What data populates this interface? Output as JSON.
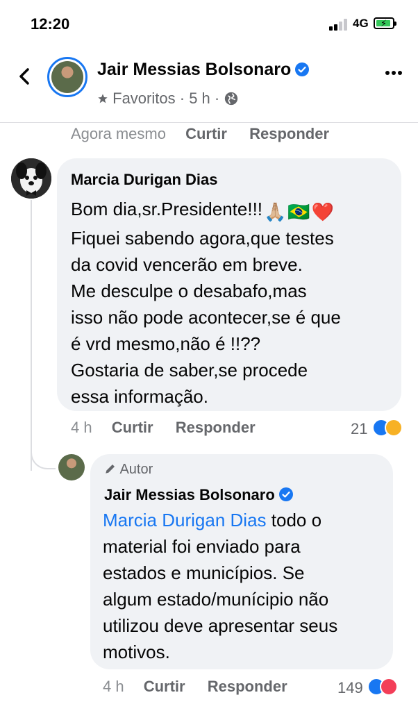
{
  "status_bar": {
    "time": "12:20",
    "network": "4G"
  },
  "header": {
    "page_name": "Jair Messias Bolsonaro",
    "favorites_label": "Favoritos",
    "separator": "·",
    "time_ago": "5 h"
  },
  "top_actions": {
    "time": "Agora mesmo",
    "like": "Curtir",
    "reply": "Responder"
  },
  "comment": {
    "author": "Marcia Durigan Dias",
    "lines": [
      "Bom dia,sr.Presidente!!!",
      "Fiquei sabendo agora,que testes",
      "da covid vencerão em breve.",
      "Me desculpe o desabafo,mas",
      "isso não pode acontecer,se é que",
      "é vrd mesmo,não é !!??",
      "Gostaria de saber,se procede",
      "essa informação."
    ],
    "emojis": [
      "🙏🏼",
      "🇧🇷",
      "❤️"
    ],
    "time": "4 h",
    "like": "Curtir",
    "reply": "Responder",
    "reaction_count": "21"
  },
  "reply": {
    "badge": "Autor",
    "author": "Jair Messias Bolsonaro",
    "mention": "Marcia Durigan Dias",
    "line1_rest": " todo o",
    "lines": [
      "material foi enviado para",
      "estados e municípios. Se",
      "algum estado/munícipio não",
      "utilizou deve apresentar seus",
      "motivos."
    ],
    "time": "4 h",
    "like": "Curtir",
    "reply": "Responder",
    "reaction_count": "149"
  },
  "colors": {
    "accent": "#1877f2",
    "bubble": "#f0f2f5",
    "muted": "#65676b"
  }
}
